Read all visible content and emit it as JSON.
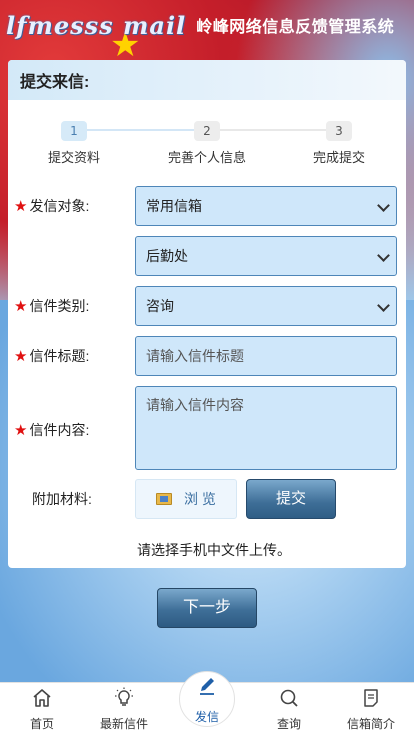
{
  "header": {
    "logo_text": "lfmesss mail",
    "title": "岭峰网络信息反馈管理系统"
  },
  "card": {
    "title": "提交来信:"
  },
  "steps": [
    {
      "num": "1",
      "label": "提交资料",
      "active": true
    },
    {
      "num": "2",
      "label": "完善个人信息",
      "active": false
    },
    {
      "num": "3",
      "label": "完成提交",
      "active": false
    }
  ],
  "form": {
    "recipient": {
      "label": "发信对象:",
      "required": true,
      "value": "常用信箱"
    },
    "department": {
      "value": "后勤处"
    },
    "category": {
      "label": "信件类别:",
      "required": true,
      "value": "咨询"
    },
    "subject": {
      "label": "信件标题:",
      "required": true,
      "placeholder": "请输入信件标题"
    },
    "content": {
      "label": "信件内容:",
      "required": true,
      "placeholder": "请输入信件内容"
    },
    "attachment": {
      "label": "附加材料:",
      "browse_label": "浏 览",
      "submit_label": "提交"
    },
    "hint": "请选择手机中文件上传。"
  },
  "next_button": "下一步",
  "tabbar": [
    {
      "label": "首页",
      "icon": "home-icon"
    },
    {
      "label": "最新信件",
      "icon": "lightbulb-icon"
    },
    {
      "label": "发信",
      "icon": "pen-icon",
      "active": true
    },
    {
      "label": "查询",
      "icon": "search-icon"
    },
    {
      "label": "信箱简介",
      "icon": "document-icon"
    }
  ],
  "colors": {
    "field_bg": "#cfe7fa",
    "field_border": "#4e86b8",
    "button": "#3e6e97",
    "required": "#e01010",
    "active_tab": "#1f5fa8"
  }
}
